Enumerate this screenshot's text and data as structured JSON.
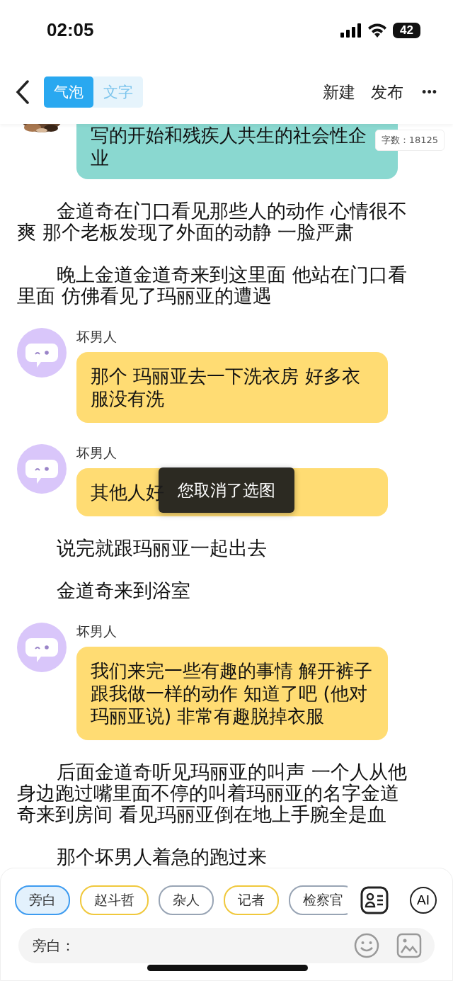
{
  "status_bar": {
    "time": "02:05",
    "battery": "42"
  },
  "header": {
    "modes": [
      {
        "label": "气泡",
        "selected": true
      },
      {
        "label": "文字",
        "selected": false
      }
    ],
    "actions": [
      "新建",
      "发布"
    ],
    "more": "•••"
  },
  "word_count": "字数：18125",
  "messages": [
    {
      "kind": "bubble_cut",
      "color": "#8ad8d0",
      "text": "写的开始和残疾人共生的社会性企业"
    },
    {
      "kind": "narration",
      "text": "金道奇在门口看见那些人的动作 心情很不爽 那个老板发现了外面的动静 一脸严肃"
    },
    {
      "kind": "narration",
      "text": "晚上金道金道奇来到这里面 他站在门口看里面 仿佛看见了玛丽亚的遭遇"
    },
    {
      "kind": "bubble",
      "speaker": "坏男人",
      "color": "#ffdc73",
      "text": "那个 玛丽亚去一下洗衣房 好多衣服没有洗"
    },
    {
      "kind": "bubble",
      "speaker": "坏男人",
      "color": "#ffdc73",
      "text": "其他人好"
    },
    {
      "kind": "narration",
      "text": "说完就跟玛丽亚一起出去"
    },
    {
      "kind": "narration",
      "text": "金道奇来到浴室"
    },
    {
      "kind": "bubble",
      "speaker": "坏男人",
      "color": "#ffdc73",
      "text": "我们来完一些有趣的事情 解开裤子跟我做一样的动作 知道了吧 (他对玛丽亚说) 非常有趣脱掉衣服"
    },
    {
      "kind": "narration",
      "text": "后面金道奇听见玛丽亚的叫声 一个人从他身边跑过嘴里面不停的叫着玛丽亚的名字金道奇来到房间 看见玛丽亚倒在地上手腕全是血"
    },
    {
      "kind": "narration",
      "text": "那个坏男人着急的跑过来"
    }
  ],
  "toast": "您取消了选图",
  "roles": [
    {
      "label": "旁白",
      "selected": true,
      "color": "#3d9bf0"
    },
    {
      "label": "赵斗哲",
      "selected": false,
      "color": "#f0c83c"
    },
    {
      "label": "杂人",
      "selected": false,
      "color": "#98a4b4"
    },
    {
      "label": "记者",
      "selected": false,
      "color": "#f0c83c"
    },
    {
      "label": "检察官",
      "selected": false,
      "color": "#98a4b4"
    }
  ],
  "ai_button": "AI",
  "input": {
    "placeholder": "旁白："
  }
}
